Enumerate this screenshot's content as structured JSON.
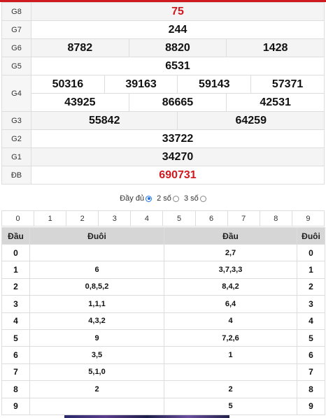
{
  "results": {
    "rows": [
      {
        "label": "G8",
        "values": [
          "75"
        ],
        "red": true
      },
      {
        "label": "G7",
        "values": [
          "244"
        ]
      },
      {
        "label": "G6",
        "values": [
          "8782",
          "8820",
          "1428"
        ]
      },
      {
        "label": "G5",
        "values": [
          "6531"
        ]
      },
      {
        "label": "G4",
        "values": [
          "50316",
          "39163",
          "59143",
          "57371",
          "43925",
          "86665",
          "42531"
        ]
      },
      {
        "label": "G3",
        "values": [
          "55842",
          "64259"
        ]
      },
      {
        "label": "G2",
        "values": [
          "33722"
        ]
      },
      {
        "label": "G1",
        "values": [
          "34270"
        ]
      },
      {
        "label": "ĐB",
        "values": [
          "690731"
        ],
        "red": true
      }
    ]
  },
  "filter": {
    "full_label": "Đầy đủ",
    "two_label": "2 số",
    "three_label": "3 số",
    "selected": "full"
  },
  "digits": [
    "0",
    "1",
    "2",
    "3",
    "4",
    "5",
    "6",
    "7",
    "8",
    "9"
  ],
  "loto": {
    "headers": [
      "Đầu",
      "Đuôi",
      "Đầu",
      "Đuôi"
    ],
    "rows": [
      {
        "key": "0",
        "tails": "",
        "heads": "2,7",
        "key2": "0"
      },
      {
        "key": "1",
        "tails": "6",
        "heads": "3,7,3,3",
        "key2": "1"
      },
      {
        "key": "2",
        "tails": "0,8,5,2",
        "heads": "8,4,2",
        "key2": "2"
      },
      {
        "key": "3",
        "tails": "1,1,1",
        "heads": "6,4",
        "key2": "3"
      },
      {
        "key": "4",
        "tails": "4,3,2",
        "heads": "4",
        "key2": "4"
      },
      {
        "key": "5",
        "tails": "9",
        "heads": "7,2,6",
        "key2": "5"
      },
      {
        "key": "6",
        "tails": "3,5",
        "heads": "1",
        "key2": "6"
      },
      {
        "key": "7",
        "tails": "5,1,0",
        "heads": "",
        "key2": "7"
      },
      {
        "key": "8",
        "tails": "2",
        "heads": "2",
        "key2": "8"
      },
      {
        "key": "9",
        "tails": "",
        "heads": "5",
        "key2": "9"
      }
    ]
  },
  "colors": {
    "accent": "#d0191f",
    "radio": "#1e73e8"
  }
}
